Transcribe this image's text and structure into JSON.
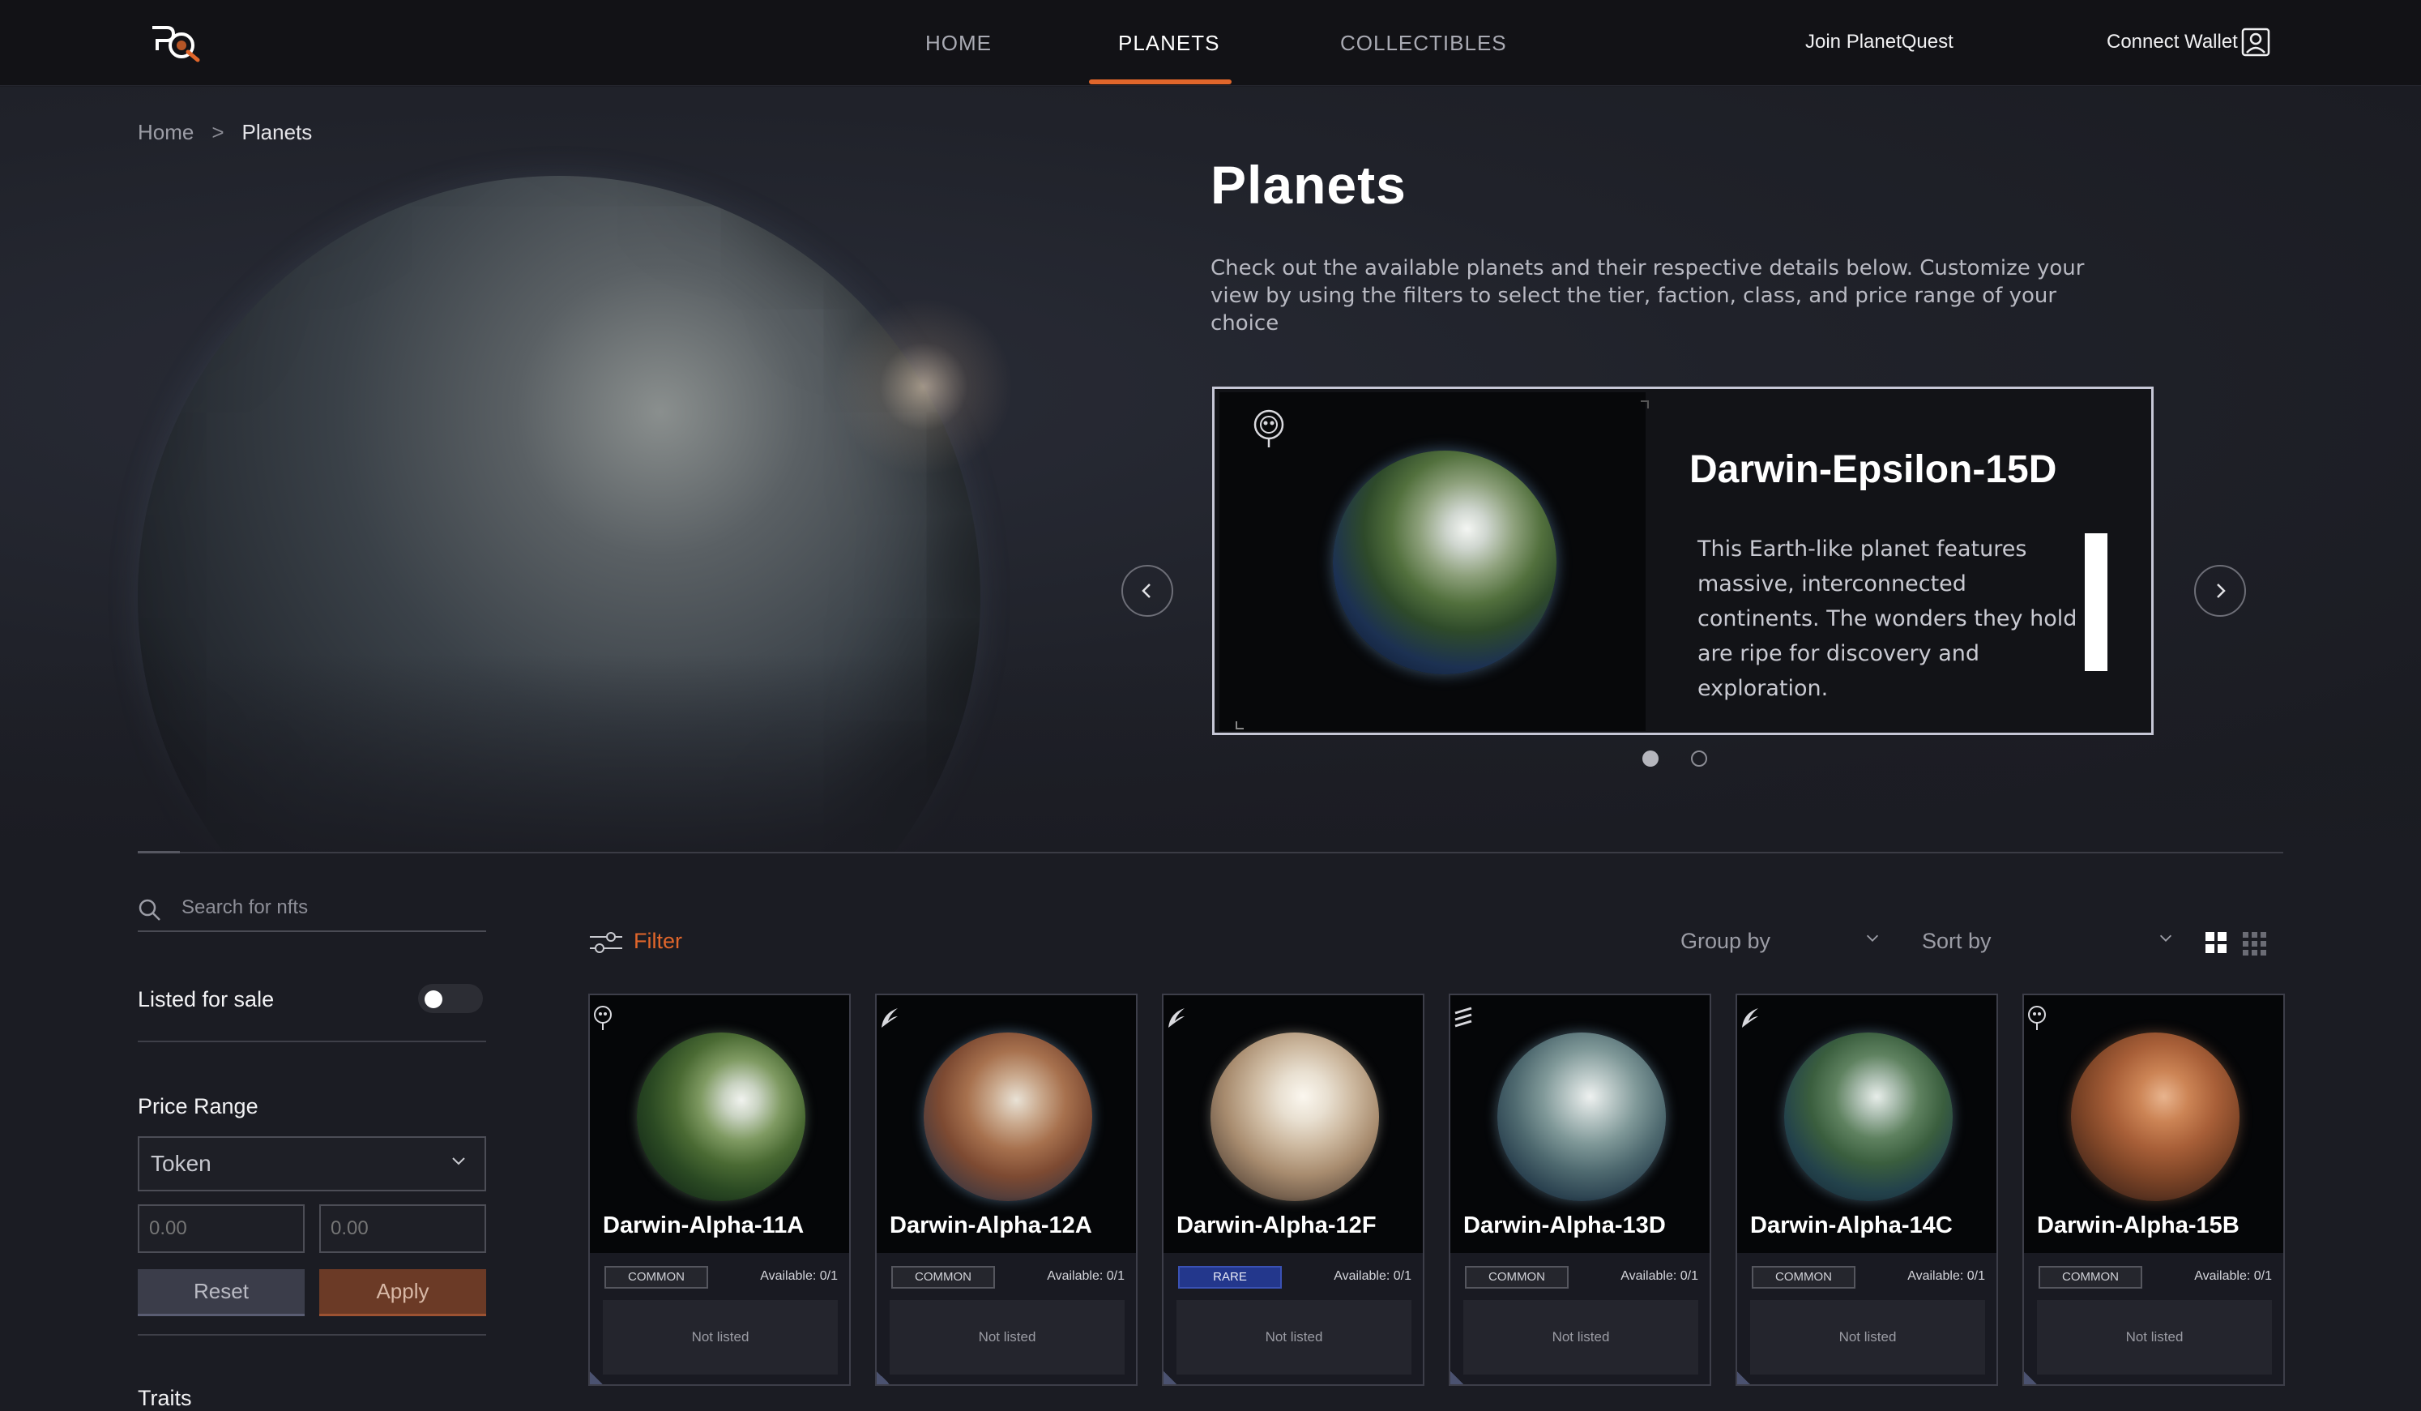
{
  "nav": {
    "links": [
      "HOME",
      "PLANETS",
      "COLLECTIBLES"
    ],
    "join_label": "Join PlanetQuest",
    "wallet_label": "Connect Wallet",
    "accent_color": "#e0662b"
  },
  "breadcrumb": {
    "home": "Home",
    "separator": ">",
    "current": "Planets"
  },
  "hero": {
    "title": "Planets",
    "description": "Check out the available planets and their respective details below. Customize your view by using the filters to select the tier, faction, class, and price range of your choice"
  },
  "featured": {
    "name": "Darwin-Epsilon-15D",
    "description": "This Earth-like planet features massive, interconnected continents. The wonders they hold are ripe for discovery and exploration.",
    "prev_icon": "chevron-left-icon",
    "next_icon": "chevron-right-icon",
    "slide_count": 2,
    "active_slide": 1
  },
  "sidebar": {
    "search_placeholder": "Search for nfts",
    "listed_label": "Listed for sale",
    "listed_on": false,
    "price_label": "Price Range",
    "token_value": "Token",
    "min_placeholder": "0.00",
    "max_placeholder": "0.00",
    "reset_label": "Reset",
    "apply_label": "Apply",
    "traits_label": "Traits"
  },
  "toolbar": {
    "filter_label": "Filter",
    "group_label": "Group by",
    "sort_label": "Sort by"
  },
  "cards": [
    {
      "name": "Darwin-Alpha-11A",
      "tier": "COMMON",
      "available": "Available: 0/1",
      "status": "Not listed",
      "badge": "alien-badge-icon"
    },
    {
      "name": "Darwin-Alpha-12A",
      "tier": "COMMON",
      "available": "Available: 0/1",
      "status": "Not listed",
      "badge": "wing-badge-icon"
    },
    {
      "name": "Darwin-Alpha-12F",
      "tier": "RARE",
      "available": "Available: 0/1",
      "status": "Not listed",
      "badge": "wing-badge-icon"
    },
    {
      "name": "Darwin-Alpha-13D",
      "tier": "COMMON",
      "available": "Available: 0/1",
      "status": "Not listed",
      "badge": "chevron-badge-icon"
    },
    {
      "name": "Darwin-Alpha-14C",
      "tier": "COMMON",
      "available": "Available: 0/1",
      "status": "Not listed",
      "badge": "wing-badge-icon"
    },
    {
      "name": "Darwin-Alpha-15B",
      "tier": "COMMON",
      "available": "Available: 0/1",
      "status": "Not listed",
      "badge": "alien-badge-icon"
    }
  ]
}
